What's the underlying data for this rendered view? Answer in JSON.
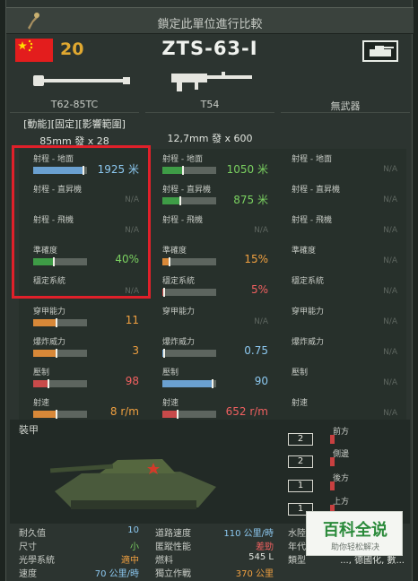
{
  "top_bar": {
    "title": "鎖定此單位進行比較"
  },
  "header": {
    "tier": "20",
    "tank_name": "ZTS-63-I"
  },
  "columns": [
    {
      "weapon": "T62-85TC",
      "modifiers": "[動能][固定][影響範圍]",
      "ammo": "85mm 發 x 28"
    },
    {
      "weapon": "T54",
      "ammo": "12,7mm 發 x 600"
    },
    {
      "weapon": "無武器"
    }
  ],
  "stat_labels": {
    "range_ground": "射程 - 地面",
    "range_heli": "射程 - 直昇機",
    "range_air": "射程 - 飛機",
    "accuracy": "準確度",
    "stabilizer": "穩定系統",
    "penetration": "穿甲能力",
    "he_power": "爆炸威力",
    "suppression": "壓制",
    "rof": "射速"
  },
  "na_text": "N/A",
  "col1_stats": {
    "range_ground": {
      "value": "1925 米",
      "bar": 0.95
    },
    "range_heli": {
      "value": "N/A"
    },
    "range_air": {
      "value": "N/A"
    },
    "accuracy": {
      "value": "40%",
      "bar": 0.4
    },
    "stabilizer": {
      "value": "N/A"
    },
    "penetration": {
      "value": "11",
      "bar": 0.45
    },
    "he_power": {
      "value": "3",
      "bar": 0.45
    },
    "suppression": {
      "value": "98",
      "bar": 0.3
    },
    "rof": {
      "value": "8 r/m",
      "bar": 0.45
    }
  },
  "col2_stats": {
    "range_ground": {
      "value": "1050 米",
      "bar": 0.4
    },
    "range_heli": {
      "value": "875 米",
      "bar": 0.35
    },
    "range_air": {
      "value": "N/A"
    },
    "accuracy": {
      "value": "15%",
      "bar": 0.15
    },
    "stabilizer": {
      "value": "5%",
      "bar": 0.05
    },
    "penetration": {
      "value": "N/A"
    },
    "he_power": {
      "value": "0.75",
      "bar": 0.05
    },
    "suppression": {
      "value": "90",
      "bar": 0.95
    },
    "rof": {
      "value": "652 r/m",
      "bar": 0.3
    }
  },
  "armor": {
    "title": "裝甲",
    "rows": [
      {
        "value": "2",
        "label": "前方"
      },
      {
        "value": "2",
        "label": "側邊"
      },
      {
        "value": "1",
        "label": "後方"
      },
      {
        "value": "1",
        "label": "上方"
      }
    ]
  },
  "specs": [
    {
      "label": "耐久值",
      "value": "10"
    },
    {
      "label": "尺寸",
      "value": "小"
    },
    {
      "label": "光學系統",
      "value": "適中"
    },
    {
      "label": "速度",
      "value": "70 公里/時"
    },
    {
      "label": "道路速度",
      "value": "110 公里/時"
    },
    {
      "label": "匿蹤性能",
      "value": "差勁"
    },
    {
      "label": "燃料",
      "value": "545 L"
    },
    {
      "label": "獨立作戰",
      "value": "370 公里"
    },
    {
      "label": "水陸",
      "value": ""
    },
    {
      "label": "年代",
      "value": ""
    },
    {
      "label": "類型",
      "value": "..., 德國化, 數..."
    }
  ],
  "watermark": {
    "title": "百科全说",
    "subtitle": "助你轻松解决"
  },
  "colors": {
    "blue_bar": "#6aa0d0",
    "green_bar": "#3e9c46",
    "orange_bar": "#d88838",
    "red_bar": "#c84a4a",
    "val_blue": "#8cc8f0",
    "val_green": "#7ad060",
    "val_orange": "#f0a040",
    "val_red": "#f06060",
    "highlight": "#e0202a"
  }
}
